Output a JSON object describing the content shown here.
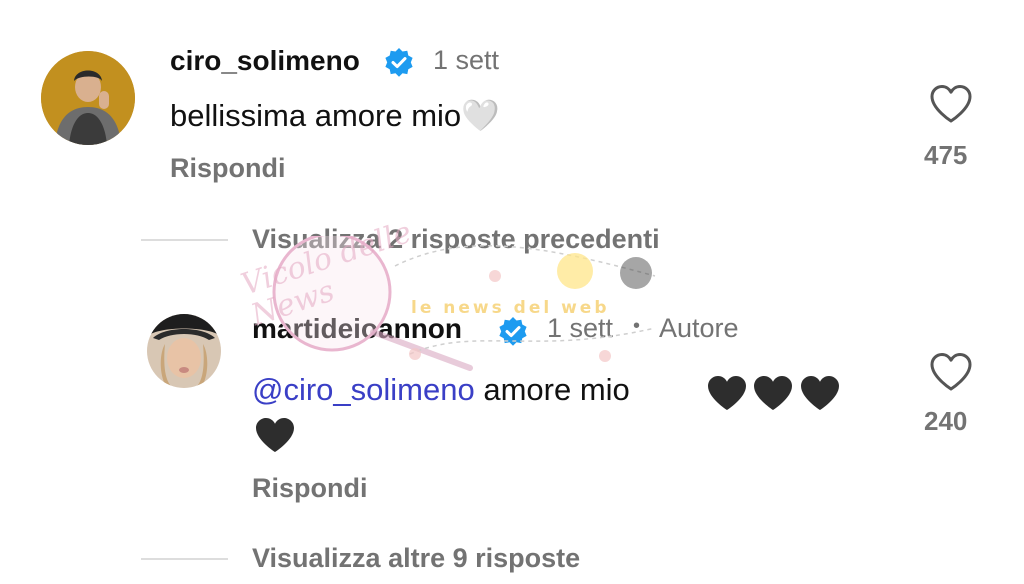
{
  "comment": {
    "username": "ciro_solimeno",
    "time": "1 sett",
    "text": "bellissima amore mio",
    "emoji": "🤍",
    "reply_label": "Rispondi",
    "like_count": "475"
  },
  "view_previous": {
    "label": "Visualizza 2 risposte precedenti"
  },
  "reply": {
    "username": "martideioannon",
    "time": "1 sett",
    "separator": "•",
    "author_label": "Autore",
    "mention": "@ciro_solimeno",
    "text": " amore mio",
    "reply_label": "Rispondi",
    "like_count": "240"
  },
  "view_more": {
    "label": "Visualizza altre 9 risposte"
  },
  "watermark": {
    "text": "Vicolo delle News",
    "tagline": "le news del web"
  },
  "colors": {
    "mention": "#3a3fc6",
    "verified": "#1d9bf0",
    "meta": "#737373"
  }
}
